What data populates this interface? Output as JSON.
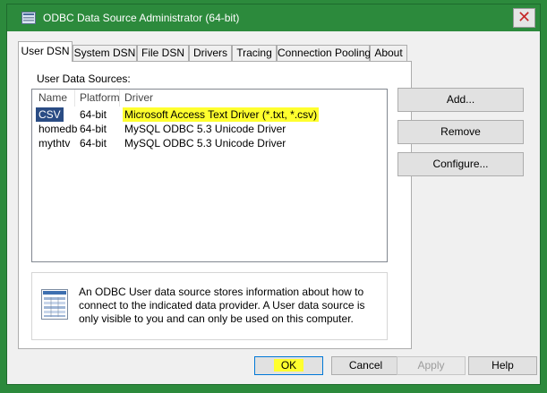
{
  "window": {
    "title": "ODBC Data Source Administrator (64-bit)",
    "close_glyph": "✕"
  },
  "tabs": [
    {
      "label": "User DSN",
      "active": true
    },
    {
      "label": "System DSN"
    },
    {
      "label": "File DSN"
    },
    {
      "label": "Drivers"
    },
    {
      "label": "Tracing"
    },
    {
      "label": "Connection Pooling"
    },
    {
      "label": "About"
    }
  ],
  "panel": {
    "list_label": "User Data Sources:",
    "columns": [
      "Name",
      "Platform",
      "Driver"
    ],
    "rows": [
      {
        "name": "CSV",
        "platform": "64-bit",
        "driver": "Microsoft Access Text Driver (*.txt, *.csv)",
        "selected": true,
        "highlighted": true
      },
      {
        "name": "homedb",
        "platform": "64-bit",
        "driver": "MySQL ODBC 5.3 Unicode Driver"
      },
      {
        "name": "mythtv",
        "platform": "64-bit",
        "driver": "MySQL ODBC 5.3 Unicode Driver"
      }
    ],
    "info_text": "An ODBC User data source stores information about how to connect to the indicated data provider.  A User data source is only visible to you and can only be used on this computer.",
    "info_icon": "data-source-info-icon"
  },
  "side_buttons": {
    "add": "Add...",
    "remove": "Remove",
    "configure": "Configure..."
  },
  "bottom_buttons": {
    "ok": "OK",
    "cancel": "Cancel",
    "apply": "Apply",
    "help": "Help"
  },
  "colors": {
    "frame": "#2c8a3c",
    "selection": "#2a4c84",
    "highlight": "#ffff2e"
  }
}
